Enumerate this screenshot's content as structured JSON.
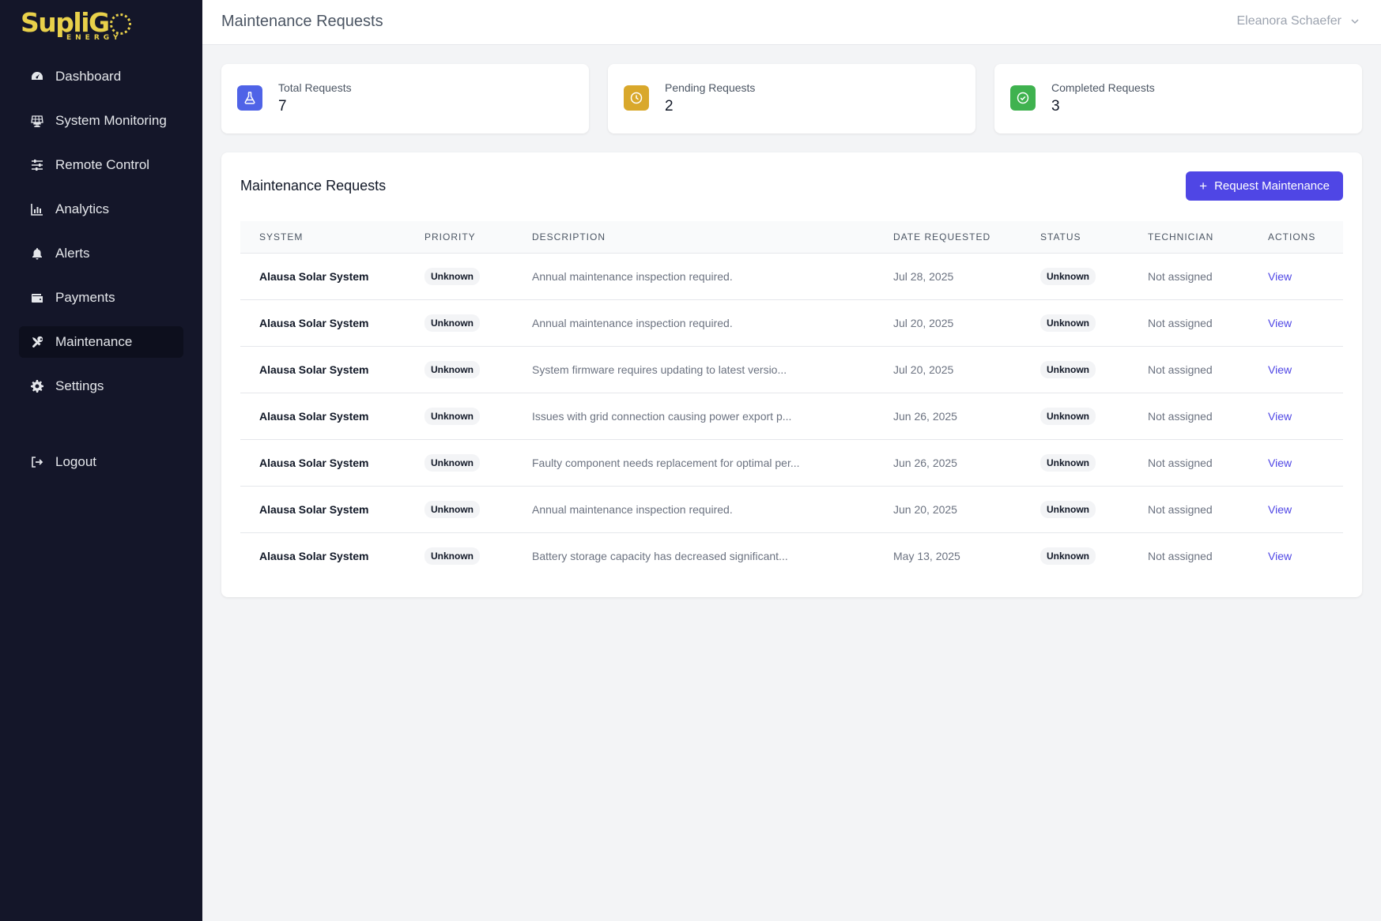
{
  "brand": {
    "name": "SupliG",
    "subtitle": "ENERGY",
    "color": "#e9d14a"
  },
  "sidebar": {
    "items": [
      {
        "label": "Dashboard",
        "icon": "gauge-icon"
      },
      {
        "label": "System Monitoring",
        "icon": "solar-panel-icon"
      },
      {
        "label": "Remote Control",
        "icon": "sliders-icon"
      },
      {
        "label": "Analytics",
        "icon": "chart-bar-icon"
      },
      {
        "label": "Alerts",
        "icon": "bell-icon"
      },
      {
        "label": "Payments",
        "icon": "wallet-icon"
      },
      {
        "label": "Maintenance",
        "icon": "tools-icon",
        "active": true
      },
      {
        "label": "Settings",
        "icon": "gear-icon"
      }
    ],
    "logout": {
      "label": "Logout",
      "icon": "logout-icon"
    }
  },
  "header": {
    "title": "Maintenance Requests",
    "user_name": "Eleanora Schaefer"
  },
  "stats": [
    {
      "label": "Total Requests",
      "value": "7",
      "icon": "flask-icon",
      "color": "#4f63e7"
    },
    {
      "label": "Pending Requests",
      "value": "2",
      "icon": "clock-icon",
      "color": "#d9a82b"
    },
    {
      "label": "Completed Requests",
      "value": "3",
      "icon": "check-circle-icon",
      "color": "#3fb24f"
    }
  ],
  "panel": {
    "title": "Maintenance Requests",
    "button_label": "Request Maintenance",
    "columns": [
      "SYSTEM",
      "PRIORITY",
      "DESCRIPTION",
      "DATE REQUESTED",
      "STATUS",
      "TECHNICIAN",
      "ACTIONS"
    ],
    "rows": [
      {
        "system": "Alausa Solar System",
        "priority": "Unknown",
        "description": "Annual maintenance inspection required.",
        "date": "Jul 28, 2025",
        "status": "Unknown",
        "technician": "Not assigned",
        "action": "View"
      },
      {
        "system": "Alausa Solar System",
        "priority": "Unknown",
        "description": "Annual maintenance inspection required.",
        "date": "Jul 20, 2025",
        "status": "Unknown",
        "technician": "Not assigned",
        "action": "View"
      },
      {
        "system": "Alausa Solar System",
        "priority": "Unknown",
        "description": "System firmware requires updating to latest versio...",
        "date": "Jul 20, 2025",
        "status": "Unknown",
        "technician": "Not assigned",
        "action": "View"
      },
      {
        "system": "Alausa Solar System",
        "priority": "Unknown",
        "description": "Issues with grid connection causing power export p...",
        "date": "Jun 26, 2025",
        "status": "Unknown",
        "technician": "Not assigned",
        "action": "View"
      },
      {
        "system": "Alausa Solar System",
        "priority": "Unknown",
        "description": "Faulty component needs replacement for optimal per...",
        "date": "Jun 26, 2025",
        "status": "Unknown",
        "technician": "Not assigned",
        "action": "View"
      },
      {
        "system": "Alausa Solar System",
        "priority": "Unknown",
        "description": "Annual maintenance inspection required.",
        "date": "Jun 20, 2025",
        "status": "Unknown",
        "technician": "Not assigned",
        "action": "View"
      },
      {
        "system": "Alausa Solar System",
        "priority": "Unknown",
        "description": "Battery storage capacity has decreased significant...",
        "date": "May 13, 2025",
        "status": "Unknown",
        "technician": "Not assigned",
        "action": "View"
      }
    ]
  }
}
